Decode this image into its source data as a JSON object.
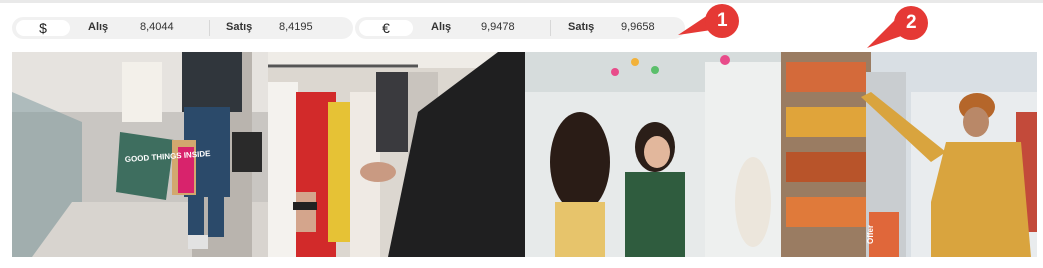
{
  "exchange_rates": [
    {
      "currency_symbol": "$",
      "buy_label": "Alış",
      "buy_value": "8,4044",
      "sell_label": "Satış",
      "sell_value": "8,4195"
    },
    {
      "currency_symbol": "€",
      "buy_label": "Alış",
      "buy_value": "9,9478",
      "sell_label": "Satış",
      "sell_value": "9,9658"
    }
  ],
  "annotations": [
    {
      "number": "1",
      "color": "#e53935"
    },
    {
      "number": "2",
      "color": "#e53935"
    }
  ],
  "photos": [
    {
      "subject": "shopper-walking-with-bags",
      "bag_text": "GOOD THINGS INSIDE"
    },
    {
      "subject": "clothing-rack-shopping"
    },
    {
      "subject": "women-shopping-boutique"
    },
    {
      "subject": "man-in-grocery-aisle",
      "sign_text": "Offer"
    }
  ]
}
